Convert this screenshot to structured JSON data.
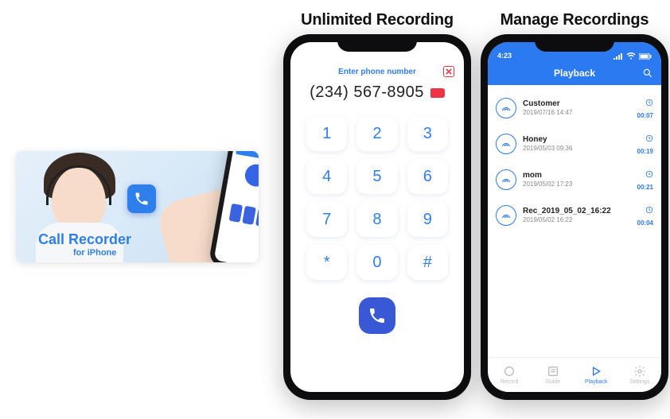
{
  "promo": {
    "title": "Call Recorder",
    "subtitle": "for iPhone"
  },
  "shot1": {
    "heading": "Unlimited Recording",
    "prompt": "Enter phone number",
    "number": "(234) 567-8905",
    "keys": [
      "1",
      "2",
      "3",
      "4",
      "5",
      "6",
      "7",
      "8",
      "9",
      "*",
      "0",
      "#"
    ]
  },
  "shot2": {
    "heading": "Manage Recordings",
    "status_time": "4:23",
    "title": "Playback",
    "recordings": [
      {
        "name": "Customer",
        "date": "2019/07/16 14:47",
        "duration": "00:07"
      },
      {
        "name": "Honey",
        "date": "2019/05/03 09:36",
        "duration": "00:19"
      },
      {
        "name": "mom",
        "date": "2019/05/02 17:23",
        "duration": "00:21"
      },
      {
        "name": "Rec_2019_05_02_16:22",
        "date": "2019/05/02 16:22",
        "duration": "00:04"
      }
    ],
    "tabs": [
      {
        "id": "record",
        "label": "Record",
        "active": false
      },
      {
        "id": "guide",
        "label": "Guide",
        "active": false
      },
      {
        "id": "playback",
        "label": "Playback",
        "active": true
      },
      {
        "id": "settings",
        "label": "Settings",
        "active": false
      }
    ]
  }
}
